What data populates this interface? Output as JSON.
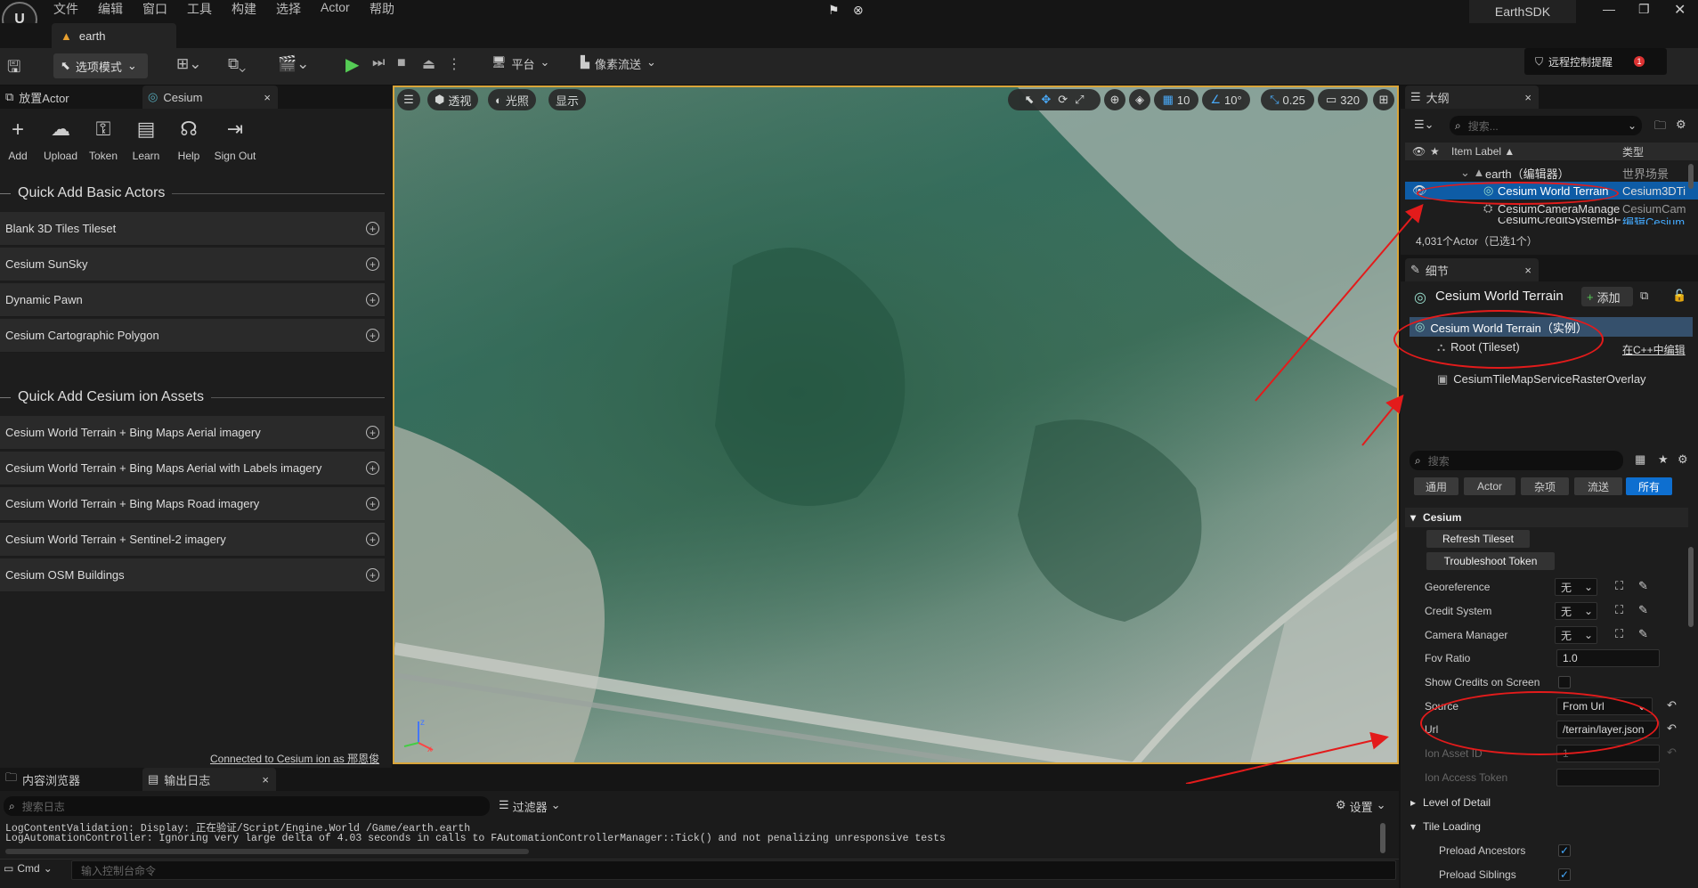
{
  "menu": {
    "items": [
      "文件",
      "编辑",
      "窗口",
      "工具",
      "构建",
      "选择",
      "Actor",
      "帮助"
    ],
    "app_name": "EarthSDK"
  },
  "tab": {
    "title": "earth"
  },
  "toolbar": {
    "mode": "选项模式",
    "platform": "平台",
    "pixel_stream": "像素流送",
    "remote": "远程控制提醒",
    "remote_badge": "1"
  },
  "left": {
    "tab1": "放置Actor",
    "tab2": "Cesium",
    "tools": [
      "Add",
      "Upload",
      "Token",
      "Learn",
      "Help",
      "Sign Out"
    ],
    "section1": "Quick Add Basic Actors",
    "basic": [
      "Blank 3D Tiles Tileset",
      "Cesium SunSky",
      "Dynamic Pawn",
      "Cesium Cartographic Polygon"
    ],
    "section2": "Quick Add Cesium ion Assets",
    "ion": [
      "Cesium World Terrain + Bing Maps Aerial imagery",
      "Cesium World Terrain + Bing Maps Aerial with Labels imagery",
      "Cesium World Terrain + Bing Maps Road imagery",
      "Cesium World Terrain + Sentinel-2 imagery",
      "Cesium OSM Buildings"
    ],
    "connected": "Connected to Cesium ion as 邢恩俊"
  },
  "viewport": {
    "perspective": "透视",
    "lit": "光照",
    "show": "显示",
    "grid": "10",
    "angle": "10°",
    "scale": "0.25",
    "cam": "320"
  },
  "bottom": {
    "tab1": "内容浏览器",
    "tab2": "输出日志",
    "search_ph": "搜索日志",
    "filter": "过滤器",
    "settings": "设置",
    "log1": "LogContentValidation: Display: 正在验证/Script/Engine.World /Game/earth.earth",
    "log2": "LogAutomationController: Ignoring very large delta of 4.03 seconds in calls to FAutomationControllerManager::Tick() and not penalizing unresponsive tests",
    "cmd": "Cmd",
    "cmd_ph": "输入控制台命令"
  },
  "outliner": {
    "title": "大纲",
    "search_ph": "搜索...",
    "col_label": "Item Label ▲",
    "col_type": "类型",
    "rows": [
      {
        "label": "earth（编辑器）",
        "type": "世界场景"
      },
      {
        "label": "Cesium World Terrain",
        "type": "Cesium3DTi"
      },
      {
        "label": "CesiumCameraManage",
        "type": "CesiumCam"
      },
      {
        "label": "CesiumCreditSystemBF",
        "type": "编辑Cesium"
      }
    ],
    "count": "4,031个Actor（已选1个）"
  },
  "details": {
    "title": "细节",
    "object": "Cesium World Terrain",
    "add": "添加",
    "instance": "Cesium World Terrain（实例）",
    "root": "Root (Tileset)",
    "edit_cpp": "在C++中编辑",
    "overlay": "CesiumTileMapServiceRasterOverlay",
    "search_ph": "搜索",
    "filters": [
      "通用",
      "Actor",
      "杂项",
      "流送",
      "所有"
    ],
    "cat": "Cesium",
    "refresh": "Refresh Tileset",
    "troubleshoot": "Troubleshoot Token",
    "props": [
      {
        "label": "Georeference",
        "value": "无"
      },
      {
        "label": "Credit System",
        "value": "无"
      },
      {
        "label": "Camera Manager",
        "value": "无"
      },
      {
        "label": "Fov Ratio",
        "value": "1.0"
      },
      {
        "label": "Show Credits on Screen",
        "value": ""
      },
      {
        "label": "Source",
        "value": "From Url"
      },
      {
        "label": "Url",
        "value": "/terrain/layer.json"
      },
      {
        "label": "Ion Asset ID",
        "value": "1"
      },
      {
        "label": "Ion Access Token",
        "value": ""
      }
    ],
    "lod": "Level of Detail",
    "tile_loading": "Tile Loading",
    "preload_ancestors": "Preload Ancestors",
    "preload_siblings": "Preload Siblings"
  }
}
